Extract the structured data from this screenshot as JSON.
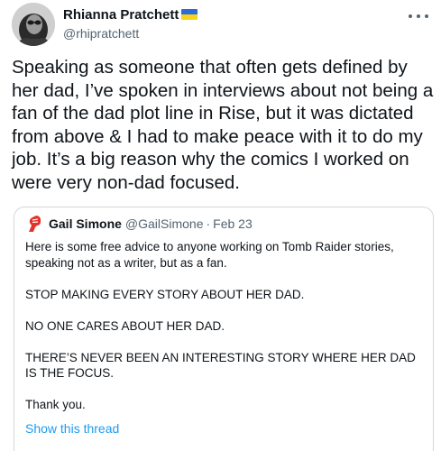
{
  "tweet": {
    "author_name": "Rhianna Pratchett",
    "author_flag_icon": "ukraine-flag-icon",
    "author_handle": "@rhipratchett",
    "text": "Speaking as someone that often gets defined by her dad, I’ve spoken in interviews about not being a fan of the dad plot line in Rise, but it was dictated from above & I had to make peace with it to do my job. It’s a big reason why the comics I worked on were very non-dad focused."
  },
  "quote": {
    "author_name": "Gail Simone",
    "author_handle": "@GailSimone",
    "separator": "·",
    "date": "Feb 23",
    "paragraphs": [
      "Here is some free advice to anyone working on Tomb Raider stories, speaking not as a writer, but as a fan.",
      "STOP MAKING EVERY STORY ABOUT HER DAD.",
      "NO ONE CARES ABOUT HER DAD.",
      "THERE’S NEVER BEEN AN INTERESTING STORY WHERE HER DAD IS THE FOCUS.",
      "Thank you."
    ],
    "show_thread_label": "Show this thread"
  },
  "colors": {
    "link": "#1d9bf0",
    "secondary_text": "#536471",
    "border": "#cfd9de"
  }
}
